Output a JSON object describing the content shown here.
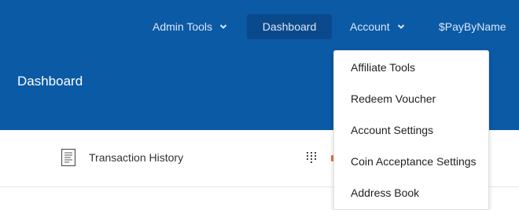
{
  "nav": {
    "admin_tools": "Admin Tools",
    "dashboard": "Dashboard",
    "account": "Account",
    "paybyname": "$PayByName"
  },
  "page": {
    "title": "Dashboard"
  },
  "content": {
    "transaction_history": "Transaction History"
  },
  "dropdown": {
    "items": [
      "Affiliate Tools",
      "Redeem Voucher",
      "Account Settings",
      "Coin Acceptance Settings",
      "Address Book"
    ]
  },
  "colors": {
    "header_bg": "#0b5aa6",
    "active_nav_bg": "#0a4a8c",
    "accent_orange": "#e8703a"
  }
}
